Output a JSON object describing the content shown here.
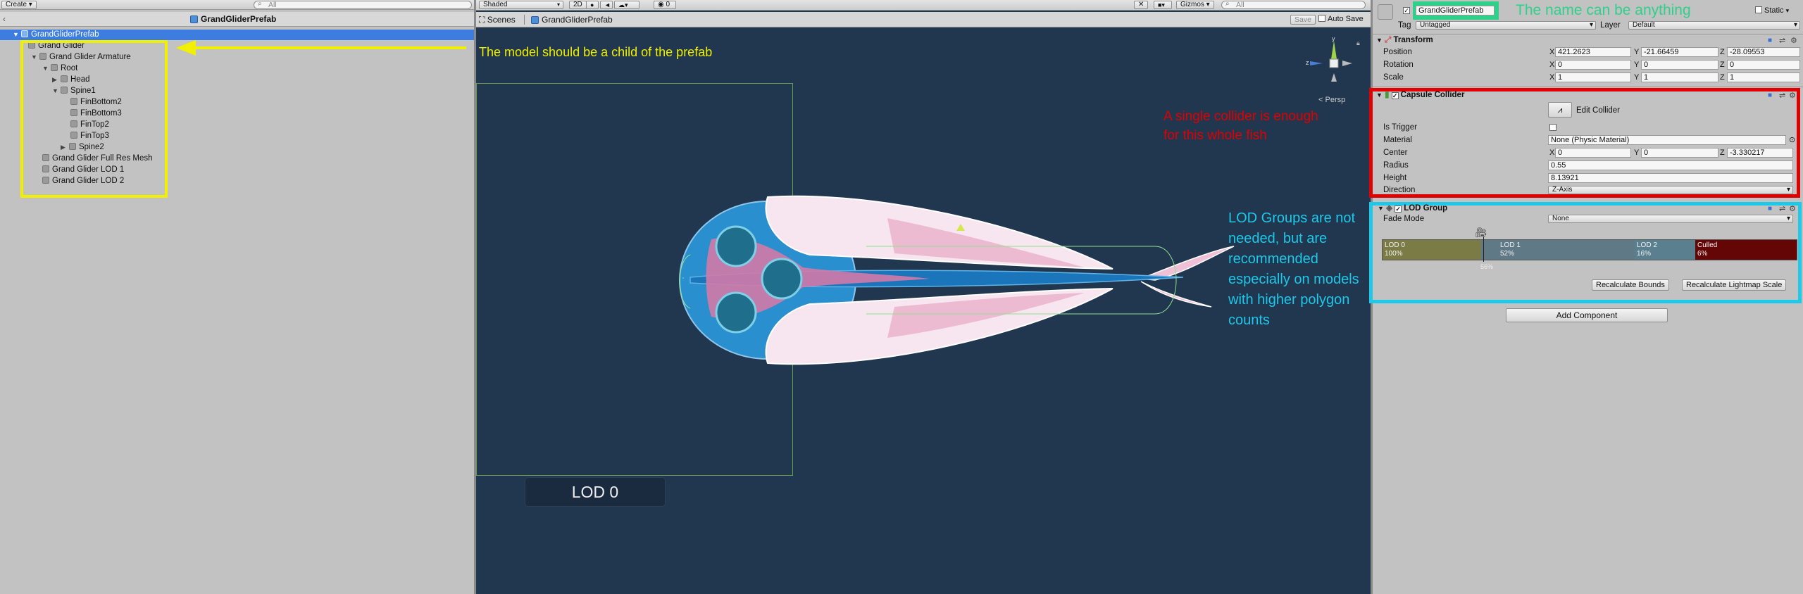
{
  "hierarchy": {
    "create_label": "Create ▾",
    "search_placeholder": "All",
    "title": "GrandGliderPrefab",
    "items": [
      {
        "label": "GrandGliderPrefab"
      },
      {
        "label": "Grand Glider"
      },
      {
        "label": "Grand Glider Armature"
      },
      {
        "label": "Root"
      },
      {
        "label": "Head"
      },
      {
        "label": "Spine1"
      },
      {
        "label": "FinBottom2"
      },
      {
        "label": "FinBottom3"
      },
      {
        "label": "FinTop2"
      },
      {
        "label": "FinTop3"
      },
      {
        "label": "Spine2"
      },
      {
        "label": "Grand Glider Full Res Mesh"
      },
      {
        "label": "Grand Glider LOD 1"
      },
      {
        "label": "Grand Glider LOD 2"
      }
    ]
  },
  "scene": {
    "shading_mode": "Shaded",
    "mode_2d": "2D",
    "effects_count": "0",
    "gizmos_label": "Gizmos ▾",
    "search_placeholder": "All",
    "breadcrumb_root": "Scenes",
    "breadcrumb_prefab": "GrandGliderPrefab",
    "save_label": "Save",
    "autosave_label": "Auto Save",
    "persp_label": "Persp",
    "lod_label": "LOD 0",
    "axis_y": "y",
    "axis_z": "z"
  },
  "annotations": {
    "model_child": "The model should be a child of the prefab",
    "single_collider": "A single collider is enough for this whole fish",
    "lod_groups": "LOD Groups are not needed, but are recommended especially on models with higher polygon counts",
    "name_anything": "The name can be anything",
    "colors": {
      "yellow": "#f0f000",
      "red": "#e00000",
      "cyan": "#1ec8e8",
      "green": "#2ed08a"
    }
  },
  "inspector": {
    "object_name": "GrandGliderPrefab",
    "static_label": "Static",
    "tag_label": "Tag",
    "tag_value": "Untagged",
    "layer_label": "Layer",
    "layer_value": "Default",
    "transform": {
      "title": "Transform",
      "position_label": "Position",
      "rotation_label": "Rotation",
      "scale_label": "Scale",
      "position": {
        "x": "421.2623",
        "y": "-21.66459",
        "z": "-28.09553"
      },
      "rotation": {
        "x": "0",
        "y": "0",
        "z": "0"
      },
      "scale": {
        "x": "1",
        "y": "1",
        "z": "1"
      }
    },
    "capsule": {
      "title": "Capsule Collider",
      "edit_label": "Edit Collider",
      "is_trigger_label": "Is Trigger",
      "material_label": "Material",
      "material_value": "None (Physic Material)",
      "center_label": "Center",
      "center": {
        "x": "0",
        "y": "0",
        "z": "-3.330217"
      },
      "radius_label": "Radius",
      "radius_value": "0.55",
      "height_label": "Height",
      "height_value": "8.13921",
      "direction_label": "Direction",
      "direction_value": "Z-Axis"
    },
    "lod_group": {
      "title": "LOD Group",
      "fade_mode_label": "Fade Mode",
      "fade_mode_value": "None",
      "marker": "56%",
      "segments": [
        {
          "name": "LOD 0",
          "pct": "100%"
        },
        {
          "name": "LOD 1",
          "pct": "52%"
        },
        {
          "name": "LOD 2",
          "pct": "16%"
        },
        {
          "name": "Culled",
          "pct": "6%"
        }
      ],
      "recalc_bounds": "Recalculate Bounds",
      "recalc_lightmap": "Recalculate Lightmap Scale"
    },
    "add_component": "Add Component",
    "axis_x": "X",
    "axis_y": "Y",
    "axis_z": "Z"
  }
}
